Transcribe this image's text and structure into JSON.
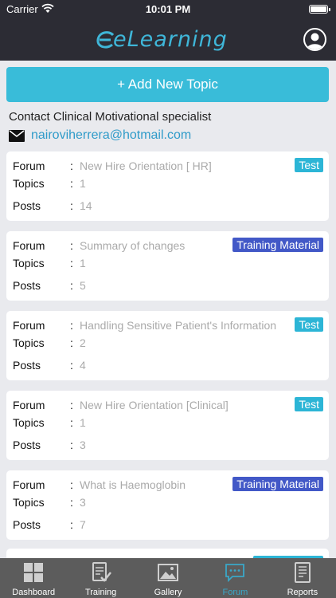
{
  "status_bar": {
    "carrier": "Carrier",
    "time": "10:01 PM"
  },
  "header": {
    "logo_text": "eLearning"
  },
  "add_button": {
    "label": "+ Add New Topic"
  },
  "contact": {
    "label": "Contact Clinical Motivational specialist",
    "email": "nairoviherrera@hotmail.com"
  },
  "field_labels": {
    "forum": "Forum",
    "topics": "Topics",
    "posts": "Posts",
    "colon": ":"
  },
  "forums": [
    {
      "forum": "New Hire Orientation [ HR]",
      "topics": "1",
      "posts": "14",
      "badge": "Test",
      "badge_type": "test"
    },
    {
      "forum": "Summary of changes",
      "topics": "1",
      "posts": "5",
      "badge": "Training Material",
      "badge_type": "training"
    },
    {
      "forum": "Handling Sensitive Patient's Information",
      "topics": "2",
      "posts": "4",
      "badge": "Test",
      "badge_type": "test"
    },
    {
      "forum": "New Hire Orientation [Clinical]",
      "topics": "1",
      "posts": "3",
      "badge": "Test",
      "badge_type": "test"
    },
    {
      "forum": "What is Haemoglobin",
      "topics": "3",
      "posts": "7",
      "badge": "Training Material",
      "badge_type": "training"
    }
  ],
  "colors": {
    "accent": "#39bcd9",
    "test_badge": "#2cb5d6",
    "training_badge": "#4258c7",
    "nav_bg": "#2c2c34",
    "tab_bg": "#5c5c5c"
  },
  "tabs": [
    {
      "label": "Dashboard",
      "icon": "dashboard-icon",
      "active": false
    },
    {
      "label": "Training",
      "icon": "training-icon",
      "active": false
    },
    {
      "label": "Gallery",
      "icon": "gallery-icon",
      "active": false
    },
    {
      "label": "Forum",
      "icon": "forum-icon",
      "active": true
    },
    {
      "label": "Reports",
      "icon": "reports-icon",
      "active": false
    }
  ]
}
